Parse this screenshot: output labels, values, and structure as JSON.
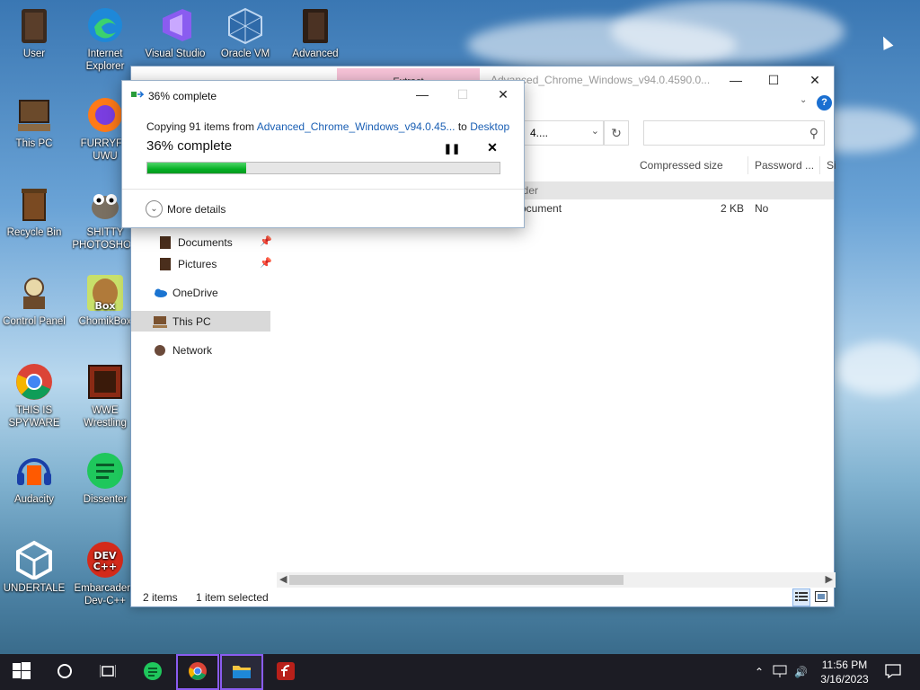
{
  "desktop": {
    "icons": [
      {
        "label": "User"
      },
      {
        "label": "Internet\nExplorer"
      },
      {
        "label": "Visual Studio"
      },
      {
        "label": "Oracle VM"
      },
      {
        "label": "Advanced"
      },
      {
        "label": "This PC"
      },
      {
        "label": "FURRYFC\nUWU"
      },
      {
        "label": "Recycle Bin"
      },
      {
        "label": "SHITTY\nPHOTOSHOP"
      },
      {
        "label": "Control Panel"
      },
      {
        "label": "ChomikBox"
      },
      {
        "label": "THIS IS\nSPYWARE"
      },
      {
        "label": "WWE\nWrestling"
      },
      {
        "label": "Audacity"
      },
      {
        "label": "Dissenter"
      },
      {
        "label": "UNDERTALE"
      },
      {
        "label": "Embarcadero\nDev-C++"
      }
    ]
  },
  "explorer": {
    "tool_tab": "Extract",
    "title": "Advanced_Chrome_Windows_v94.0.4590.0...",
    "address_tail": "4....",
    "columns": [
      "Compressed size",
      "Password ...",
      "Si"
    ],
    "group_header": "lder",
    "file": {
      "type": "ocument",
      "compressed_size": "2 KB",
      "password": "No"
    },
    "nav": [
      {
        "label": "Documents"
      },
      {
        "label": "Pictures"
      },
      {
        "label": "OneDrive"
      },
      {
        "label": "This PC"
      },
      {
        "label": "Network"
      }
    ],
    "status_items": "2 items",
    "status_selected": "1 item selected"
  },
  "copy_dialog": {
    "title": "36% complete",
    "copy_prefix": "Copying 91 items from ",
    "source": "Advanced_Chrome_Windows_v94.0.45...",
    "to_text": " to ",
    "destination": "Desktop",
    "percent_text": "36% complete",
    "progress": 0.28,
    "more_details": "More details"
  },
  "taskbar": {
    "time": "11:56 PM",
    "date": "3/16/2023"
  }
}
